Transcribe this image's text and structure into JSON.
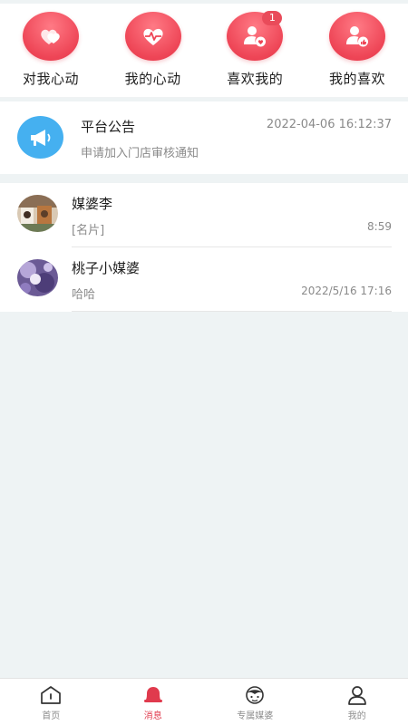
{
  "quick_actions": [
    {
      "label": "对我心动",
      "icon": "heart-double-icon"
    },
    {
      "label": "我的心动",
      "icon": "heart-pulse-icon"
    },
    {
      "label": "喜欢我的",
      "icon": "user-heart-icon",
      "badge": "1"
    },
    {
      "label": "我的喜欢",
      "icon": "user-like-icon"
    }
  ],
  "notice": {
    "title": "平台公告",
    "time": "2022-04-06 16:12:37",
    "subtitle": "申请加入门店审核通知"
  },
  "chats": [
    {
      "name": "媒婆李",
      "message": "[名片]",
      "time": "8:59"
    },
    {
      "name": "桃子小媒婆",
      "message": "哈哈",
      "time": "2022/5/16 17:16"
    }
  ],
  "tabs": [
    {
      "label": "首页",
      "active": false
    },
    {
      "label": "消息",
      "active": true
    },
    {
      "label": "专属媒婆",
      "active": false
    },
    {
      "label": "我的",
      "active": false
    }
  ],
  "colors": {
    "accent": "#e03a4d",
    "notice_icon": "#45b0f0",
    "background": "#eef3f4"
  }
}
